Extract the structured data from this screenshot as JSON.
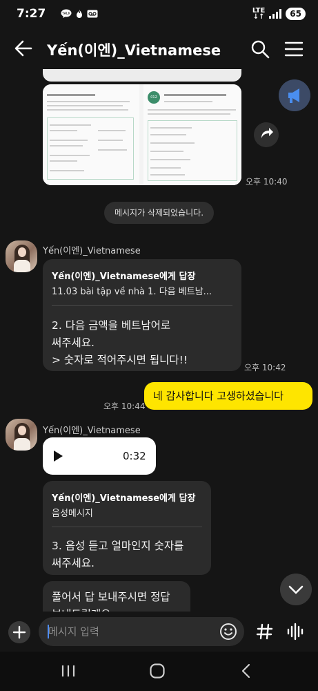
{
  "status_bar": {
    "time": "7:27",
    "icons": [
      "talk-icon",
      "fire-icon",
      "voicemail-icon"
    ],
    "network": "LTE",
    "battery": "65"
  },
  "header": {
    "title": "Yến(이엔)_Vietnamese"
  },
  "messages": {
    "image_time": "오후 10:40",
    "deleted_notice": "메시지가 삭제되었습니다.",
    "sender1": "Yến(이엔)_Vietnamese",
    "reply1": {
      "head": "Yến(이엔)_Vietnamese에게 답장",
      "quote": "11.03 bài tập về nhà  1. 다음 베트남...",
      "lines": [
        "2. 다음 금액을 베트남어로",
        "써주세요.",
        ">  숫자로 적어주시면 됩니다!!"
      ],
      "time": "오후 10:42"
    },
    "mine": {
      "text": "네 감사합니다  고생하셨습니다",
      "time": "오후 10:44"
    },
    "sender2": "Yến(이엔)_Vietnamese",
    "audio": {
      "duration": "0:32"
    },
    "reply2": {
      "head": "Yến(이엔)_Vietnamese에게 답장",
      "quote": "음성메시지",
      "lines": [
        "3. 음성 듣고 얼마인지 숫자를",
        "써주세요."
      ]
    },
    "partial": {
      "lines": [
        "풀어서 답 보내주시면 정답",
        "보내드릴게요~"
      ]
    }
  },
  "input": {
    "placeholder": "메시지 입력"
  },
  "colors": {
    "background": "#151515",
    "bubble_other": "#2b2b2b",
    "bubble_mine": "#fee500",
    "accent_blue": "#4f8df5"
  }
}
